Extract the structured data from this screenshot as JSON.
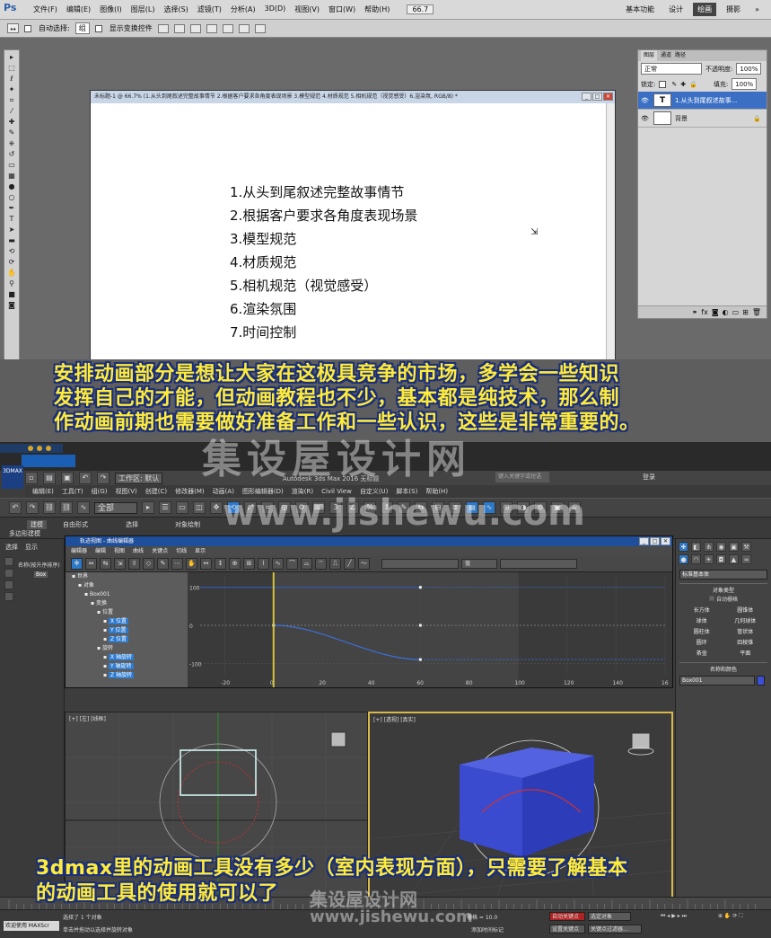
{
  "photoshop": {
    "logo": "Ps",
    "menus": [
      "文件(F)",
      "编辑(E)",
      "图像(I)",
      "图层(L)",
      "选择(S)",
      "滤镜(T)",
      "分析(A)",
      "3D(D)",
      "视图(V)",
      "窗口(W)",
      "帮助(H)"
    ],
    "zoom": "66.7",
    "workspaces": [
      "基本功能",
      "设计",
      "绘画",
      "摄影"
    ],
    "workspace_more": "»",
    "options": {
      "auto_select_label": "自动选择:",
      "auto_select_value": "组",
      "show_transform_label": "显示变换控件"
    },
    "document": {
      "title": "未标题-1 @ 66.7% (1.从头到尾叙述完整故事情节 2.根据客户要求各角度表现场景 3.模型规范 4.材质规范 5.相机规范（视觉感受）6.渲染氛, RGB/8) *",
      "lines": [
        "1.从头到尾叙述完整故事情节",
        "2.根据客户要求各角度表现场景",
        "3.模型规范",
        "4.材质规范",
        "5.相机规范（视觉感受）",
        "6.渲染氛围",
        "7.时间控制"
      ]
    },
    "layers_panel": {
      "tabs": [
        "图层",
        "通道",
        "路径"
      ],
      "blend_mode": "正常",
      "opacity_label": "不透明度:",
      "opacity_value": "100%",
      "lock_label": "锁定:",
      "fill_label": "填充:",
      "fill_value": "100%",
      "layers": [
        {
          "thumb": "T",
          "name": "1.从头到尾叙述故事..."
        },
        {
          "thumb": "",
          "name": "背景"
        }
      ]
    }
  },
  "max": {
    "logo": "3DMAX",
    "workspace_label": "工作区: 默认",
    "title_text": "Autodesk 3ds Max 2016   无标题",
    "search_placeholder": "键入关键字或短语",
    "login": "登录",
    "menus": [
      "编辑(E)",
      "工具(T)",
      "组(G)",
      "视图(V)",
      "创建(C)",
      "修改器(M)",
      "动画(A)",
      "图形编辑器(D)",
      "渲染(R)",
      "Civil View",
      "自定义(U)",
      "脚本(S)",
      "帮助(H)"
    ],
    "toolbar_select": "全部",
    "ribbon_tabs": [
      "建模",
      "自由形式",
      "选择",
      "对象绘制"
    ],
    "ribbon_sub": "多边形建模",
    "scene_tabs": [
      "选择",
      "显示"
    ],
    "scene_header": "名称(按升序排序)",
    "scene_item": "Box",
    "curve_editor": {
      "title": "轨迹视图 - 曲线编辑器",
      "menus": [
        "编辑器",
        "编辑",
        "视图",
        "曲线",
        "关键点",
        "切线",
        "显示"
      ],
      "value_label": "值",
      "tree": [
        {
          "indent": 1,
          "text": "世界",
          "hl": false
        },
        {
          "indent": 2,
          "text": "对象",
          "hl": false
        },
        {
          "indent": 3,
          "text": "Box001",
          "hl": false
        },
        {
          "indent": 4,
          "text": "变换",
          "hl": false
        },
        {
          "indent": 5,
          "text": "位置",
          "hl": false
        },
        {
          "indent": 6,
          "text": "X 位置",
          "hl": true
        },
        {
          "indent": 6,
          "text": "Y 位置",
          "hl": true
        },
        {
          "indent": 6,
          "text": "Z 位置",
          "hl": true
        },
        {
          "indent": 5,
          "text": "旋转",
          "hl": false
        },
        {
          "indent": 6,
          "text": "X 轴旋转",
          "hl": true
        },
        {
          "indent": 6,
          "text": "Y 轴旋转",
          "hl": true
        },
        {
          "indent": 6,
          "text": "Z 轴旋转",
          "hl": true
        }
      ],
      "y_ticks": [
        "100",
        "0",
        "-100"
      ],
      "x_ticks": [
        "-20",
        "0",
        "20",
        "40",
        "60",
        "80",
        "100",
        "120",
        "140",
        "16"
      ]
    },
    "viewports": {
      "left_label": "[+] [左] [线框]",
      "persp_label": "[+] [透视] [真实]"
    },
    "command_panel": {
      "dropdown": "标准基本体",
      "object_type_title": "对象类型",
      "autogrid": "自动栅格",
      "objects": [
        "长方体",
        "圆锥体",
        "球体",
        "几何球体",
        "圆柱体",
        "管状体",
        "圆环",
        "四棱锥",
        "茶壶",
        "平面"
      ],
      "name_color_title": "名称和颜色",
      "name_value": "Box001",
      "swatch_color": "#3a4fd3"
    },
    "status": {
      "welcome": "欢迎使用 MAXScr",
      "selected": "选择了 1 个对象",
      "hint": "单击并拖动以选择并旋转对象",
      "grid": "栅格 = 10.0",
      "auto_key": "自动关键点",
      "selected_obj": "选定对象",
      "set_key": "设置关键点",
      "key_filter": "关键点过滤器...",
      "add_time_tag": "添加时间标记"
    }
  },
  "subtitles": {
    "top": [
      "安排动画部分是想让大家在这极具竞争的市场，多学会一些知识",
      "发挥自己的才能，但动画教程也不少，基本都是纯技术，那么制",
      "作动画前期也需要做好准备工作和一些认识，这些是非常重要的。"
    ],
    "bottom": [
      "3dmax里的动画工具没有多少（室内表现方面），只需要了解基本",
      "的动画工具的使用就可以了"
    ]
  },
  "watermarks": {
    "brand_large": "集设屋设计网",
    "url_large": "www.jishewu.com",
    "brand_small": "集设屋设计网",
    "url_small": "www.jishewu.com"
  },
  "colors": {
    "subtitle_fill": "#ffeb3b",
    "subtitle_outline": "#1b2f7a",
    "max_selection_blue": "#2c79c9",
    "box_blue": "#3a4fd3"
  }
}
